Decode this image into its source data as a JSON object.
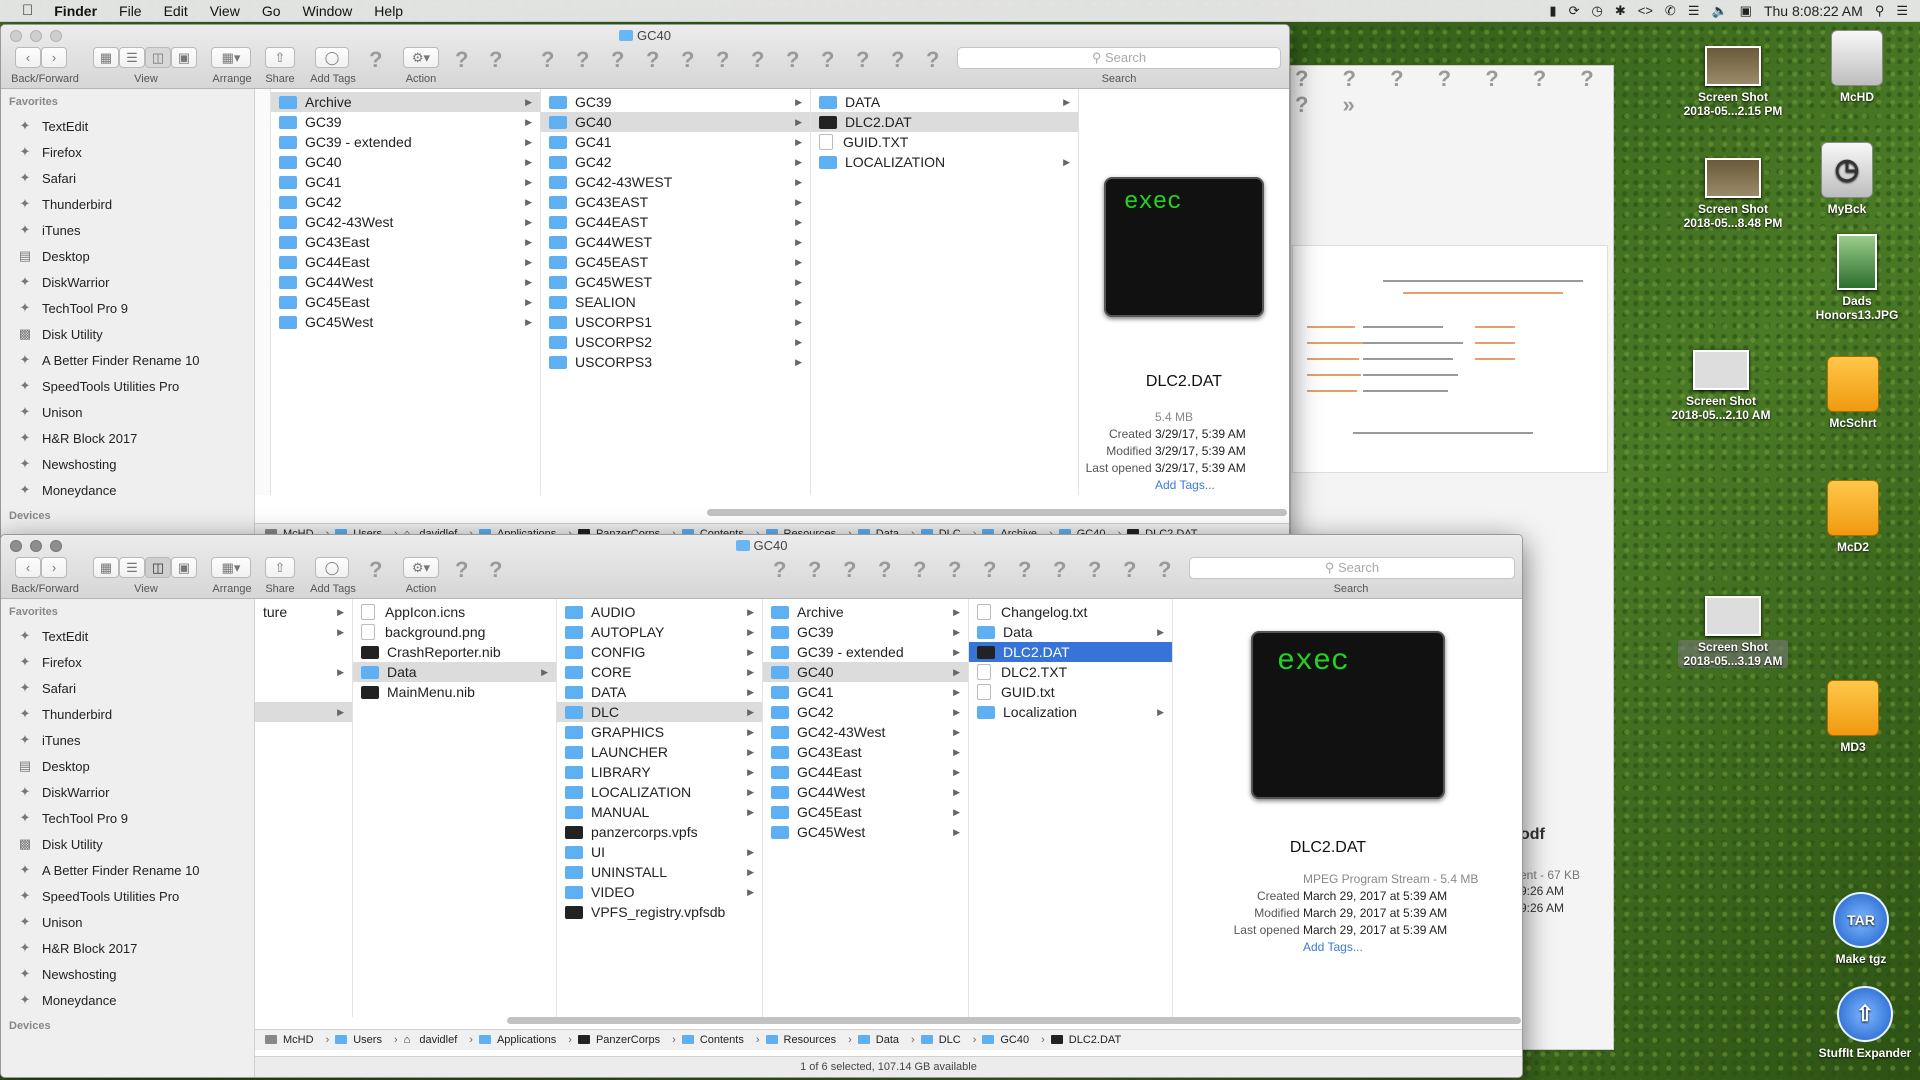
{
  "menubar": {
    "apple": "",
    "app": "Finder",
    "items": [
      "File",
      "Edit",
      "View",
      "Go",
      "Window",
      "Help"
    ],
    "clock": "Thu 8:08:22 AM"
  },
  "desktop": {
    "icons": [
      {
        "label": "Screen Shot\n2018-05...2.15 PM",
        "kind": "thumb-photo"
      },
      {
        "label": "McHD",
        "kind": "drive"
      },
      {
        "label": "Screen Shot\n2018-05...8.48 PM",
        "kind": "thumb-photo"
      },
      {
        "label": "MyBck",
        "kind": "timemachine"
      },
      {
        "label": "Dads\nHonors13.JPG",
        "kind": "thumb-green"
      },
      {
        "label": "Screen Shot\n2018-05...2.10 AM",
        "kind": "thumb-doc"
      },
      {
        "label": "McSchrt",
        "kind": "drive-orange"
      },
      {
        "label": "McD2",
        "kind": "drive-orange"
      },
      {
        "label": "Screen Shot\n2018-05...3.19 AM",
        "kind": "thumb-doc"
      },
      {
        "label": "MD3",
        "kind": "drive-orange"
      },
      {
        "label": "Make tgz",
        "kind": "tar"
      },
      {
        "label": "StuffIt Expander",
        "kind": "stuffit"
      }
    ],
    "bg_window_text": {
      "pdf": "odf",
      "size": "ent - 67 KB",
      "t1": "9:26 AM",
      "t2": "9:26 AM"
    }
  },
  "toolbar_labels": {
    "back_forward": "Back/Forward",
    "view": "View",
    "arrange": "Arrange",
    "share": "Share",
    "add_tags": "Add Tags",
    "action": "Action",
    "search": "Search",
    "search_placeholder": "Search",
    "qm": "?"
  },
  "sidebar": {
    "favorites_header": "Favorites",
    "devices_header": "Devices",
    "items": [
      "TextEdit",
      "Firefox",
      "Safari",
      "Thunderbird",
      "iTunes",
      "Desktop",
      "DiskWarrior",
      "TechTool Pro 9",
      "Disk Utility",
      "A Better Finder Rename 10",
      "SpeedTools Utilities Pro",
      "Unison",
      "H&R Block 2017",
      "Newshosting",
      "Moneydance"
    ]
  },
  "win1": {
    "title": "GC40",
    "col1": [
      "Archive",
      "GC39",
      "GC39 - extended",
      "GC40",
      "GC41",
      "GC42",
      "GC42-43West",
      "GC43East",
      "GC44East",
      "GC44West",
      "GC45East",
      "GC45West"
    ],
    "col2": [
      "GC39",
      "GC40",
      "GC41",
      "GC42",
      "GC42-43WEST",
      "GC43EAST",
      "GC44EAST",
      "GC44WEST",
      "GC45EAST",
      "GC45WEST",
      "SEALION",
      "USCORPS1",
      "USCORPS2",
      "USCORPS3"
    ],
    "col3": [
      "DATA",
      "DLC2.DAT",
      "GUID.TXT",
      "LOCALIZATION"
    ],
    "preview": {
      "icon_text": "exec",
      "name": "DLC2.DAT",
      "size": "5.4 MB",
      "created_label": "Created",
      "created": "3/29/17, 5:39 AM",
      "modified_label": "Modified",
      "modified": "3/29/17, 5:39 AM",
      "opened_label": "Last opened",
      "opened": "3/29/17, 5:39 AM",
      "add_tags": "Add Tags..."
    },
    "path": [
      "McHD",
      "Users",
      "davidlef",
      "Applications",
      "PanzerCorps",
      "Contents",
      "Resources",
      "Data",
      "DLC",
      "Archive",
      "GC40",
      "DLC2.DAT"
    ]
  },
  "win2": {
    "title": "GC40",
    "col0": [
      "ture",
      "",
      ""
    ],
    "col1": [
      "AppIcon.icns",
      "background.png",
      "CrashReporter.nib",
      "Data",
      "MainMenu.nib"
    ],
    "col2": [
      "AUDIO",
      "AUTOPLAY",
      "CONFIG",
      "CORE",
      "DATA",
      "DLC",
      "GRAPHICS",
      "LAUNCHER",
      "LIBRARY",
      "LOCALIZATION",
      "MANUAL",
      "panzercorps.vpfs",
      "UI",
      "UNINSTALL",
      "VIDEO",
      "VPFS_registry.vpfsdb"
    ],
    "col3": [
      "Archive",
      "GC39",
      "GC39 - extended",
      "GC40",
      "GC41",
      "GC42",
      "GC42-43West",
      "GC43East",
      "GC44East",
      "GC44West",
      "GC45East",
      "GC45West"
    ],
    "col4": [
      "Changelog.txt",
      "Data",
      "DLC2.DAT",
      "DLC2.TXT",
      "GUID.txt",
      "Localization"
    ],
    "preview": {
      "icon_text": "exec",
      "name": "DLC2.DAT",
      "kind_size": "MPEG Program Stream - 5.4 MB",
      "created_label": "Created",
      "created": "March 29, 2017 at 5:39 AM",
      "modified_label": "Modified",
      "modified": "March 29, 2017 at 5:39 AM",
      "opened_label": "Last opened",
      "opened": "March 29, 2017 at 5:39 AM",
      "add_tags": "Add Tags..."
    },
    "path": [
      "McHD",
      "Users",
      "davidlef",
      "Applications",
      "PanzerCorps",
      "Contents",
      "Resources",
      "Data",
      "DLC",
      "GC40",
      "DLC2.DAT"
    ],
    "status": "1 of 6 selected, 107.14 GB available"
  },
  "colors": {
    "selection": "#3874d8",
    "folder": "#5fb0f2"
  }
}
